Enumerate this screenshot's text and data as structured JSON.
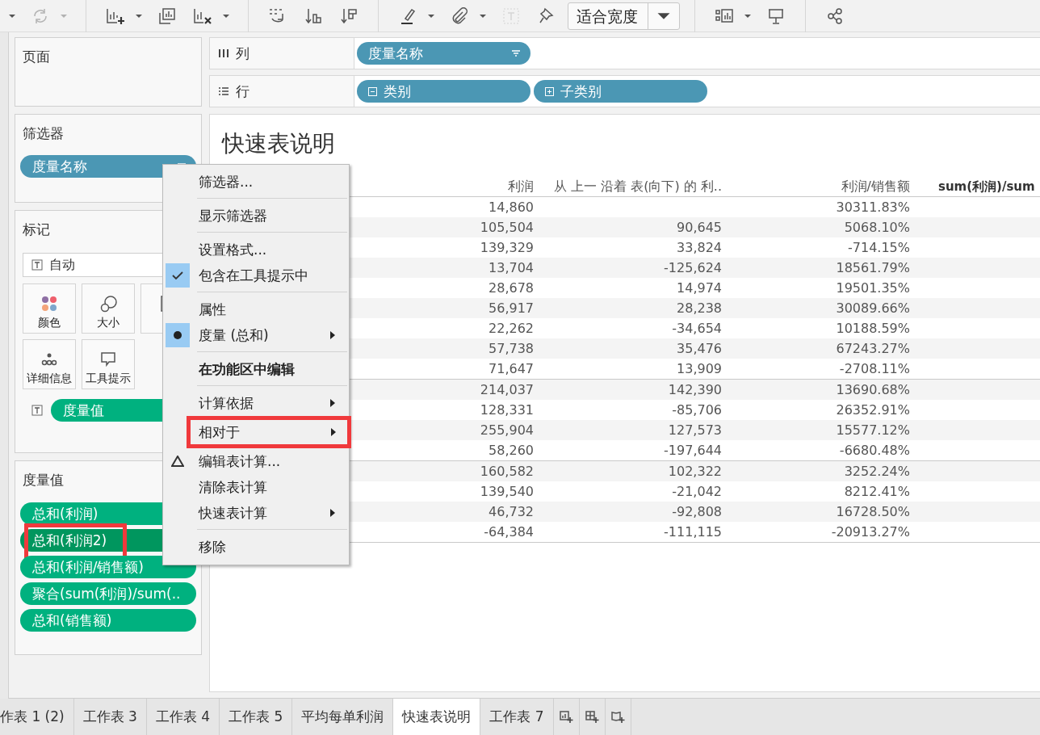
{
  "toolbar": [
    {
      "kind": "caret",
      "disabled": false
    },
    {
      "kind": "refresh",
      "disabled": true
    },
    {
      "kind": "caret",
      "disabled": true
    },
    {
      "kind": "separator"
    },
    {
      "kind": "chart-add",
      "disabled": false
    },
    {
      "kind": "caret",
      "disabled": false
    },
    {
      "kind": "chart-copy",
      "disabled": false
    },
    {
      "kind": "chart-clear",
      "disabled": false
    },
    {
      "kind": "caret",
      "disabled": false
    },
    {
      "kind": "separator"
    },
    {
      "kind": "swap",
      "disabled": false
    },
    {
      "kind": "sort-up",
      "disabled": false
    },
    {
      "kind": "sort-down",
      "disabled": false
    },
    {
      "kind": "separator"
    },
    {
      "kind": "highlight",
      "disabled": false
    },
    {
      "kind": "caret",
      "disabled": false
    },
    {
      "kind": "clip",
      "disabled": false
    },
    {
      "kind": "caret",
      "disabled": false
    },
    {
      "kind": "textbox",
      "disabled": true
    },
    {
      "kind": "pin",
      "disabled": false
    },
    {
      "kind": "dropdown",
      "value": "适合宽度"
    },
    {
      "kind": "separator"
    },
    {
      "kind": "showme",
      "disabled": false
    },
    {
      "kind": "caret",
      "disabled": false
    },
    {
      "kind": "present",
      "disabled": false
    },
    {
      "kind": "separator"
    },
    {
      "kind": "share",
      "disabled": false
    }
  ],
  "pages_card": {
    "title": "页面"
  },
  "filters_card": {
    "title": "筛选器",
    "pills": [
      {
        "label": "度量名称",
        "sorted": true
      }
    ]
  },
  "marks_card": {
    "title": "标记",
    "mark_type": "自动",
    "buttons": [
      {
        "kind": "color",
        "label": "颜色"
      },
      {
        "kind": "size",
        "label": "大小"
      },
      {
        "kind": "text"
      },
      {
        "kind": "detail",
        "label": "详细信息"
      },
      {
        "kind": "tooltip",
        "label": "工具提示"
      }
    ],
    "text_pill": {
      "label": "度量值"
    }
  },
  "measure_values_card": {
    "title": "度量值",
    "pills": [
      {
        "label": "总和(利润)",
        "selected": false,
        "highlighted": false
      },
      {
        "label": "总和(利润2)",
        "selected": true,
        "highlighted": true
      },
      {
        "label": "总和(利润/销售额)",
        "selected": false,
        "highlighted": false
      },
      {
        "label": "聚合(sum(利润)/sum(..",
        "selected": false,
        "highlighted": false
      },
      {
        "label": "总和(销售额)",
        "selected": false,
        "highlighted": false
      }
    ]
  },
  "columns_shelf": {
    "label": "列",
    "pills": [
      {
        "label": "度量名称",
        "sorted": true
      }
    ]
  },
  "rows_shelf": {
    "label": "行",
    "pills": [
      {
        "label": "类别",
        "expanded": true
      },
      {
        "label": "子类别",
        "expanded": false
      }
    ]
  },
  "view": {
    "title": "快速表说明",
    "columns": [
      {
        "label": "利润",
        "bold": false
      },
      {
        "label": "从 上一 沿着 表(向下) 的 利..",
        "bold": false
      },
      {
        "label": "利润/销售额",
        "bold": false
      },
      {
        "label": "sum(利润)/sum",
        "bold": true
      }
    ],
    "groups": [
      {
        "rows": [
          {
            "cells": [
              "14,860",
              null,
              "30311.83%"
            ]
          },
          {
            "cells": [
              "105,504",
              "90,645",
              "5068.10%"
            ]
          },
          {
            "cells": [
              "139,329",
              "33,824",
              "-714.15%"
            ]
          },
          {
            "cells": [
              "13,704",
              "-125,624",
              "18561.79%"
            ]
          },
          {
            "cells": [
              "28,678",
              "14,974",
              "19501.35%"
            ]
          },
          {
            "cells": [
              "56,917",
              "28,238",
              "30089.66%"
            ]
          },
          {
            "cells": [
              "22,262",
              "-34,654",
              "10188.59%"
            ]
          },
          {
            "cells": [
              "57,738",
              "35,476",
              "67243.27%"
            ]
          },
          {
            "cells": [
              "71,647",
              "13,909",
              "-2708.11%"
            ]
          }
        ]
      },
      {
        "rows": [
          {
            "cells": [
              "214,037",
              "142,390",
              "13690.68%"
            ]
          },
          {
            "cells": [
              "128,331",
              "-85,706",
              "26352.91%"
            ]
          },
          {
            "cells": [
              "255,904",
              "127,573",
              "15577.12%"
            ]
          },
          {
            "cells": [
              "58,260",
              "-197,644",
              "-6680.48%"
            ]
          }
        ]
      },
      {
        "rows": [
          {
            "cells": [
              "160,582",
              "102,322",
              "3252.24%"
            ]
          },
          {
            "cells": [
              "139,540",
              "-21,042",
              "8212.41%"
            ]
          },
          {
            "cells": [
              "46,732",
              "-92,808",
              "16728.50%"
            ]
          },
          {
            "cells": [
              "-64,384",
              "-111,115",
              "-20913.27%"
            ]
          }
        ]
      }
    ]
  },
  "context_menu": [
    {
      "kind": "item",
      "label": "筛选器...",
      "submenu": false,
      "bold": false,
      "highlighted": false
    },
    {
      "kind": "separator"
    },
    {
      "kind": "item",
      "label": "显示筛选器",
      "submenu": false,
      "bold": false,
      "highlighted": false
    },
    {
      "kind": "separator"
    },
    {
      "kind": "item",
      "label": "设置格式...",
      "submenu": false,
      "bold": false,
      "highlighted": false
    },
    {
      "kind": "check-item",
      "label": "包含在工具提示中",
      "checked": true,
      "submenu": false,
      "bold": false,
      "highlighted": false
    },
    {
      "kind": "separator"
    },
    {
      "kind": "item",
      "label": "属性",
      "submenu": false,
      "bold": false,
      "highlighted": false
    },
    {
      "kind": "radio-item",
      "label": "度量 (总和)",
      "checked": true,
      "submenu": true,
      "bold": false,
      "highlighted": false
    },
    {
      "kind": "separator"
    },
    {
      "kind": "item",
      "label": "在功能区中编辑",
      "submenu": false,
      "bold": true,
      "highlighted": false
    },
    {
      "kind": "separator"
    },
    {
      "kind": "item",
      "label": "计算依据",
      "submenu": true,
      "bold": false,
      "highlighted": false
    },
    {
      "kind": "item",
      "label": "相对于",
      "submenu": true,
      "bold": false,
      "highlighted": true
    },
    {
      "kind": "calc-item",
      "label": "编辑表计算...",
      "submenu": false,
      "bold": false,
      "highlighted": false
    },
    {
      "kind": "item",
      "label": "清除表计算",
      "submenu": false,
      "bold": false,
      "highlighted": false
    },
    {
      "kind": "item",
      "label": "快速表计算",
      "submenu": true,
      "bold": false,
      "highlighted": false
    },
    {
      "kind": "separator"
    },
    {
      "kind": "item",
      "label": "移除",
      "submenu": false,
      "bold": false,
      "highlighted": false
    }
  ],
  "sheet_tabs": [
    {
      "label": "作表 1 (2)",
      "selected": false
    },
    {
      "label": "工作表 3",
      "selected": false
    },
    {
      "label": "工作表 4",
      "selected": false
    },
    {
      "label": "工作表 5",
      "selected": false
    },
    {
      "label": "平均每单利润",
      "selected": false
    },
    {
      "label": "快速表说明",
      "selected": true
    },
    {
      "label": "工作表 7",
      "selected": false
    }
  ],
  "new_sheet_buttons": [
    {
      "kind": "worksheet"
    },
    {
      "kind": "dashboard"
    },
    {
      "kind": "story"
    }
  ]
}
